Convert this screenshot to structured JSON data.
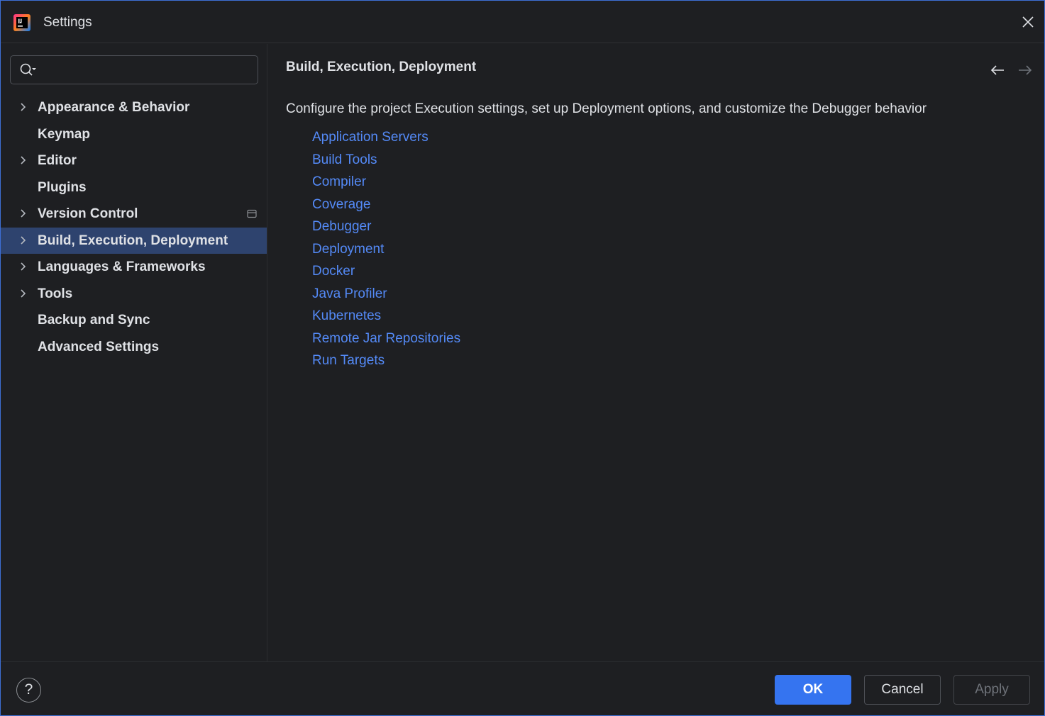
{
  "window": {
    "title": "Settings",
    "colors": {
      "background": "#1e1f22",
      "selection": "#2e436e",
      "link": "#548af7",
      "primary_button": "#3574f0"
    }
  },
  "search": {
    "value": "",
    "placeholder": ""
  },
  "sidebar": {
    "items": [
      {
        "label": "Appearance & Behavior",
        "expandable": true,
        "selected": false
      },
      {
        "label": "Keymap",
        "expandable": false,
        "selected": false
      },
      {
        "label": "Editor",
        "expandable": true,
        "selected": false
      },
      {
        "label": "Plugins",
        "expandable": false,
        "selected": false
      },
      {
        "label": "Version Control",
        "expandable": true,
        "selected": false,
        "project_icon": true
      },
      {
        "label": "Build, Execution, Deployment",
        "expandable": true,
        "selected": true
      },
      {
        "label": "Languages & Frameworks",
        "expandable": true,
        "selected": false
      },
      {
        "label": "Tools",
        "expandable": true,
        "selected": false
      },
      {
        "label": "Backup and Sync",
        "expandable": false,
        "selected": false
      },
      {
        "label": "Advanced Settings",
        "expandable": false,
        "selected": false
      }
    ]
  },
  "main": {
    "title": "Build, Execution, Deployment",
    "description": "Configure the project Execution settings, set up Deployment options, and customize the Debugger behavior",
    "links": [
      "Application Servers",
      "Build Tools",
      "Compiler",
      "Coverage",
      "Debugger",
      "Deployment",
      "Docker",
      "Java Profiler",
      "Kubernetes",
      "Remote Jar Repositories",
      "Run Targets"
    ]
  },
  "footer": {
    "help_label": "?",
    "ok_label": "OK",
    "cancel_label": "Cancel",
    "apply_label": "Apply"
  }
}
